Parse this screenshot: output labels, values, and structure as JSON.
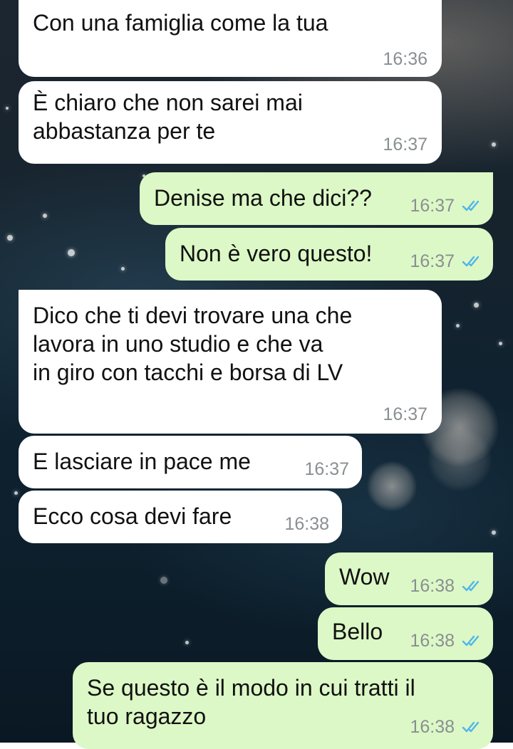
{
  "messages": [
    {
      "text": "Con una famiglia come la tua",
      "time": "16:36",
      "direction": "incoming"
    },
    {
      "text": "È chiaro che non sarei mai\nabbastanza per te",
      "time": "16:37",
      "direction": "incoming"
    },
    {
      "text": "Denise ma che dici??",
      "time": "16:37",
      "direction": "outgoing",
      "status": "read"
    },
    {
      "text": "Non è vero questo!",
      "time": "16:37",
      "direction": "outgoing",
      "status": "read"
    },
    {
      "text": "Dico che ti devi trovare una che\nlavora in uno studio e che va\nin giro con tacchi e borsa di LV",
      "time": "16:37",
      "direction": "incoming"
    },
    {
      "text": "E lasciare in pace me",
      "time": "16:37",
      "direction": "incoming"
    },
    {
      "text": "Ecco cosa devi fare",
      "time": "16:38",
      "direction": "incoming"
    },
    {
      "text": "Wow",
      "time": "16:38",
      "direction": "outgoing",
      "status": "read"
    },
    {
      "text": "Bello",
      "time": "16:38",
      "direction": "outgoing",
      "status": "read"
    },
    {
      "text": "Se questo è il modo in cui tratti il\ntuo ragazzo",
      "time": "16:38",
      "direction": "outgoing",
      "status": "read"
    }
  ],
  "colors": {
    "incoming_bubble": "#ffffff",
    "outgoing_bubble": "#dcf8c6",
    "timestamp": "#8a8f92",
    "read_ticks": "#4fb6ec"
  },
  "icons": {
    "read_receipt": "double-check-icon"
  }
}
